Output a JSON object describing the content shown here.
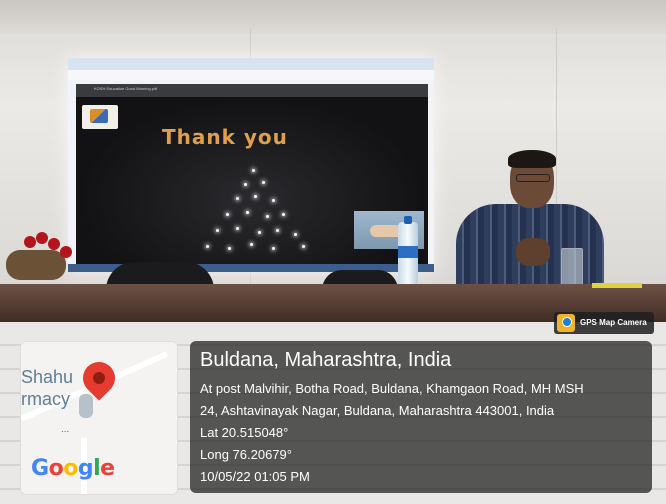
{
  "photo": {
    "slide": {
      "browser_title": "KOSH Education Good Morning.pdf",
      "heading": "Thank you"
    }
  },
  "gps_badge": {
    "label": "GPS Map Camera",
    "icon": "gps-map-camera-icon"
  },
  "map": {
    "place_label": "Shahu\nrmacy",
    "pin_icon": "location-pin-icon",
    "dots": "...",
    "logo_letters": [
      "G",
      "o",
      "o",
      "g",
      "l",
      "e"
    ]
  },
  "location": {
    "title": "Buldana, Maharashtra, India",
    "address_line1": "At post Malvihir, Botha Road, Buldana, Khamgaon Road, MH MSH",
    "address_line2": "24, Ashtavinayak Nagar, Buldana, Maharashtra 443001, India",
    "lat": "Lat 20.515048°",
    "long": "Long 76.20679°",
    "datetime": "10/05/22 01:05 PM"
  },
  "colors": {
    "pin": "#e53c2f",
    "slide_text": "#e0a04a",
    "overlay_bg": "#1c1c1c"
  }
}
